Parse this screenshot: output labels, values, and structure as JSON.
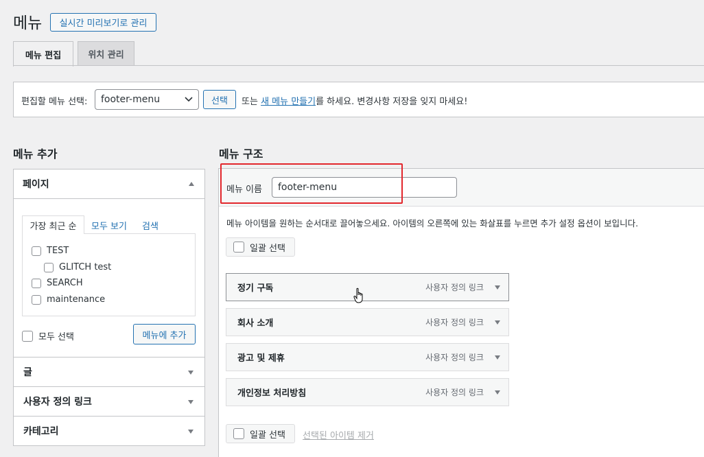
{
  "header": {
    "title": "메뉴",
    "action_label": "실시간 미리보기로 관리"
  },
  "tabs": [
    {
      "label": "메뉴 편집",
      "active": true
    },
    {
      "label": "위치 관리",
      "active": false
    }
  ],
  "manage": {
    "select_label": "편집할 메뉴 선택:",
    "selected_menu": "footer-menu",
    "select_button": "선택",
    "text_or": "또는",
    "create_link": "새 메뉴 만들기",
    "text_rest": "를 하세요. 변경사항 저장을 잊지 마세요!"
  },
  "left": {
    "heading": "메뉴 추가",
    "pages_panel": {
      "title": "페이지",
      "tabs": [
        "가장 최근 순",
        "모두 보기",
        "검색"
      ],
      "items": [
        {
          "label": "TEST",
          "indent": false
        },
        {
          "label": "GLITCH test",
          "indent": true
        },
        {
          "label": "SEARCH",
          "indent": false
        },
        {
          "label": "maintenance",
          "indent": false
        }
      ],
      "select_all": "모두 선택",
      "add_button": "메뉴에 추가"
    },
    "collapsed": [
      "글",
      "사용자 정의 링크",
      "카테고리"
    ]
  },
  "right": {
    "heading": "메뉴 구조",
    "name_label": "메뉴 이름",
    "name_value": "footer-menu",
    "instructions": "메뉴 아이템을 원하는 순서대로 끌어놓으세요. 아이템의 오른쪽에 있는 화살표를 누르면 추가 설정 옵션이 보입니다.",
    "bulk_select": "일괄 선택",
    "items": [
      {
        "name": "정기 구독",
        "type": "사용자 정의 링크"
      },
      {
        "name": "회사 소개",
        "type": "사용자 정의 링크"
      },
      {
        "name": "광고 및 제휴",
        "type": "사용자 정의 링크"
      },
      {
        "name": "개인정보 처리방침",
        "type": "사용자 정의 링크"
      }
    ],
    "remove_selected": "선택된 아이템 제거"
  },
  "colors": {
    "accent": "#2271b1",
    "highlight": "#e2262c"
  }
}
